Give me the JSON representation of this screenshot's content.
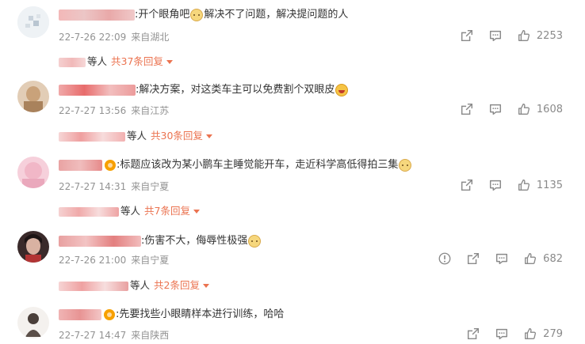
{
  "comments": [
    {
      "text_before": ":开个眼角吧",
      "text_after": "解决不了问题，解决提问题的人",
      "date": "22-7-26 22:09",
      "location": "来自湖北",
      "likes": "2253",
      "replies_who": "等人",
      "replies_count": "共37条回复"
    },
    {
      "text_before": ":解决方案，对这类车主可以免费割个双眼皮",
      "text_after": "",
      "date": "22-7-27 13:56",
      "location": "来自江苏",
      "likes": "1608",
      "replies_who": "等人",
      "replies_count": "共30条回复"
    },
    {
      "text_before": ":标题应该改为某小鹏车主睡觉能开车，走近科学高低得拍三集",
      "text_after": "",
      "date": "22-7-27 14:31",
      "location": "来自宁夏",
      "likes": "1135",
      "replies_who": "等人",
      "replies_count": "共7条回复"
    },
    {
      "text_before": ":伤害不大，侮辱性极强",
      "text_after": "",
      "date": "22-7-26 21:00",
      "location": "来自宁夏",
      "likes": "682",
      "replies_who": "等人",
      "replies_count": "共2条回复"
    },
    {
      "text_before": ":先要找些小眼睛样本进行训练，哈哈",
      "text_after": "",
      "date": "22-7-27 14:47",
      "location": "来自陕西",
      "likes": "279"
    }
  ],
  "icons": {
    "share": "share-icon",
    "comment": "comment-icon",
    "like": "thumbs-up-icon",
    "report": "report-icon",
    "dropdown": "chevron-down-icon",
    "vip_badge": "vip-badge-icon",
    "emoji_cat": "cat-face-emoji",
    "emoji_laugh": "laughing-emoji"
  },
  "colors": {
    "more_replies": "#eb7350",
    "meta": "#939393",
    "text": "#333333"
  }
}
